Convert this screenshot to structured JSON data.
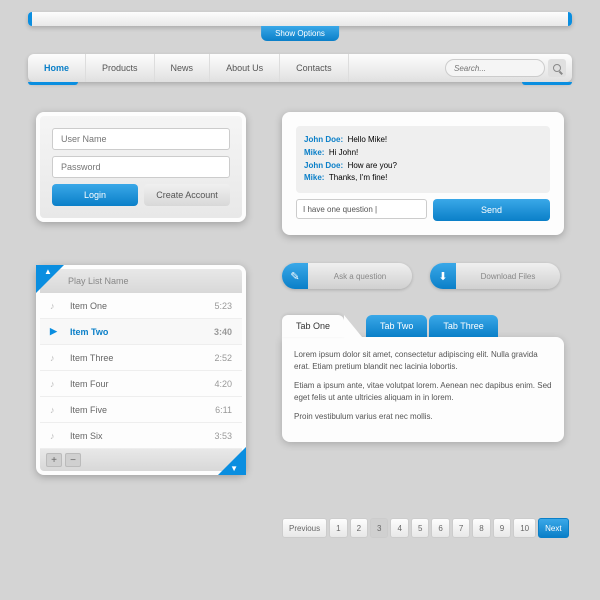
{
  "topbar": {
    "show_options": "Show Options"
  },
  "nav": {
    "items": [
      "Home",
      "Products",
      "News",
      "About Us",
      "Contacts"
    ],
    "search_placeholder": "Search..."
  },
  "login": {
    "username_ph": "User Name",
    "password_ph": "Password",
    "login_btn": "Login",
    "create_btn": "Create Account"
  },
  "chat": {
    "messages": [
      {
        "name": "John Doe:",
        "text": "Hello Mike!"
      },
      {
        "name": "Mike:",
        "text": "Hi John!"
      },
      {
        "name": "John Doe:",
        "text": "How are you?"
      },
      {
        "name": "Mike:",
        "text": "Thanks, I'm fine!"
      }
    ],
    "input_value": "I have one question |",
    "send": "Send"
  },
  "actions": {
    "ask": "Ask a question",
    "download": "Download Files"
  },
  "playlist": {
    "title": "Play List Name",
    "items": [
      {
        "name": "Item One",
        "time": "5:23",
        "active": false
      },
      {
        "name": "Item Two",
        "time": "3:40",
        "active": true
      },
      {
        "name": "Item Three",
        "time": "2:52",
        "active": false
      },
      {
        "name": "Item Four",
        "time": "4:20",
        "active": false
      },
      {
        "name": "Item Five",
        "time": "6:11",
        "active": false
      },
      {
        "name": "Item Six",
        "time": "3:53",
        "active": false
      }
    ]
  },
  "tabs": {
    "labels": [
      "Tab One",
      "Tab Two",
      "Tab Three"
    ],
    "body_p1": "Lorem ipsum dolor sit amet, consectetur adipiscing elit. Nulla gravida erat. Etiam pretium blandit nec lacinia lobortis.",
    "body_p2": "Etiam a ipsum ante, vitae volutpat lorem. Aenean nec dapibus enim. Sed eget felis ut ante ultricies aliquam in in lorem.",
    "body_p3": "Proin vestibulum varius erat nec mollis."
  },
  "pagination": {
    "prev": "Previous",
    "next": "Next",
    "pages": [
      "1",
      "2",
      "3",
      "4",
      "5",
      "6",
      "7",
      "8",
      "9",
      "10"
    ],
    "active": 3
  },
  "colors": {
    "accent": "#0a8ee0"
  }
}
